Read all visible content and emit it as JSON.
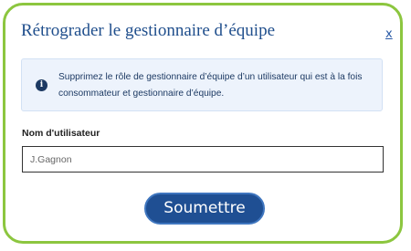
{
  "dialog": {
    "title": "Rétrograder le gestionnaire d’équipe",
    "close_label": "x"
  },
  "info": {
    "icon": "info-circle-icon",
    "message": "Supprimez le rôle de gestionnaire d’équipe d’un utilisateur qui est à la fois consommateur et gestionnaire d’équipe."
  },
  "form": {
    "username_label": "Nom d'utilisateur",
    "username_value": "J.Gagnon"
  },
  "actions": {
    "submit_label": "Soumettre"
  },
  "colors": {
    "border_accent": "#8cc63f",
    "primary": "#1f4f93",
    "title": "#1f4e8c",
    "info_bg": "#edf3fc"
  }
}
